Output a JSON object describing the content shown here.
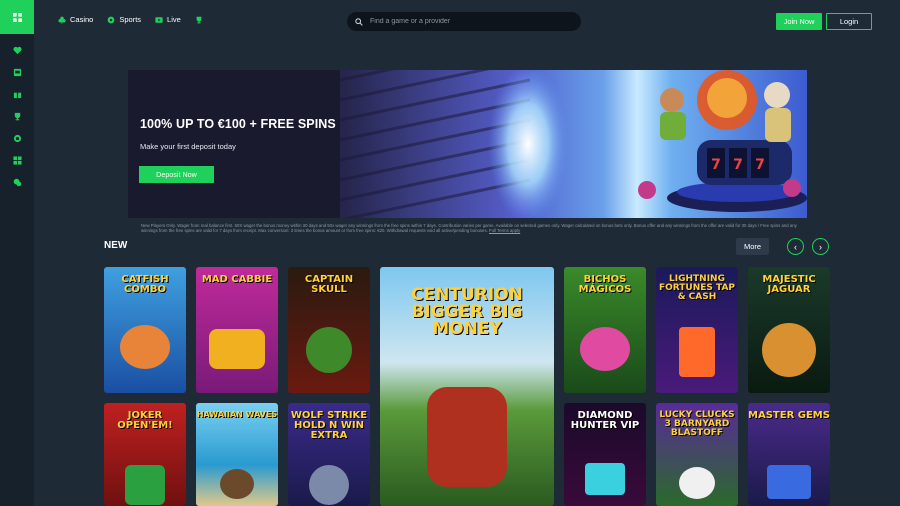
{
  "header": {
    "nav": [
      {
        "label": "Casino",
        "icon": "clubs-icon"
      },
      {
        "label": "Sports",
        "icon": "ball-icon"
      },
      {
        "label": "Live",
        "icon": "live-icon"
      },
      {
        "label": "",
        "icon": "trophy-icon"
      }
    ],
    "search_placeholder": "Find a game or a provider",
    "join_label": "Join Now",
    "login_label": "Login"
  },
  "sidebar": {
    "icons": [
      "grid-icon",
      "heart-icon",
      "slots-icon",
      "gift-icon",
      "trophy-icon",
      "chip-icon",
      "grid-icon",
      "chat-icon"
    ]
  },
  "banner": {
    "title": "100% UP TO €100 + FREE SPINS",
    "subtitle": "Make your first deposit today",
    "cta": "Deposit Now"
  },
  "fine_print": {
    "text": "New Players Only. Wager from real balance first. 50X wager the bonus money within 30 days and 50x wager any winnings from the free spins within 7 days. Contribution varies per game. Available on selected games only. Wager calculated on bonus bets only. Bonus offer and any winnings from the offer are valid for 30 days / Free spins and any winnings from the free spins are valid for 7 days from receipt. Max conversion: 3 times the bonus amount or from free spins: €20. Withdrawal requests void all active/pending bonuses.",
    "link": "Full Terms apply"
  },
  "section": {
    "title": "NEW",
    "more_label": "More",
    "prev_icon": "chevron-left-icon",
    "next_icon": "chevron-right-icon"
  },
  "games": [
    {
      "title": "CATFISH COMBO"
    },
    {
      "title": "MAD CABBIE"
    },
    {
      "title": "CAPTAIN SKULL"
    },
    {
      "title": "CENTURION BIGGER BIG MONEY"
    },
    {
      "title": "BICHOS MÁGICOS"
    },
    {
      "title": "LIGHTNING FORTUNES TAP & CASH"
    },
    {
      "title": "MAJESTIC JAGUAR"
    },
    {
      "title": "JOKER OPEN'EM!"
    },
    {
      "title": "HAWAIIAN WAVES"
    },
    {
      "title": "WOLF STRIKE HOLD N WIN EXTRA"
    },
    {
      "title": "DIAMOND HUNTER VIP"
    },
    {
      "title": "LUCKY CLUCKS 3 BARNYARD BLASTOFF"
    },
    {
      "title": "MASTER GEMS"
    }
  ],
  "colors": {
    "accent": "#1fd05a",
    "bg": "#1f2a37",
    "sidebar": "#17212c"
  }
}
